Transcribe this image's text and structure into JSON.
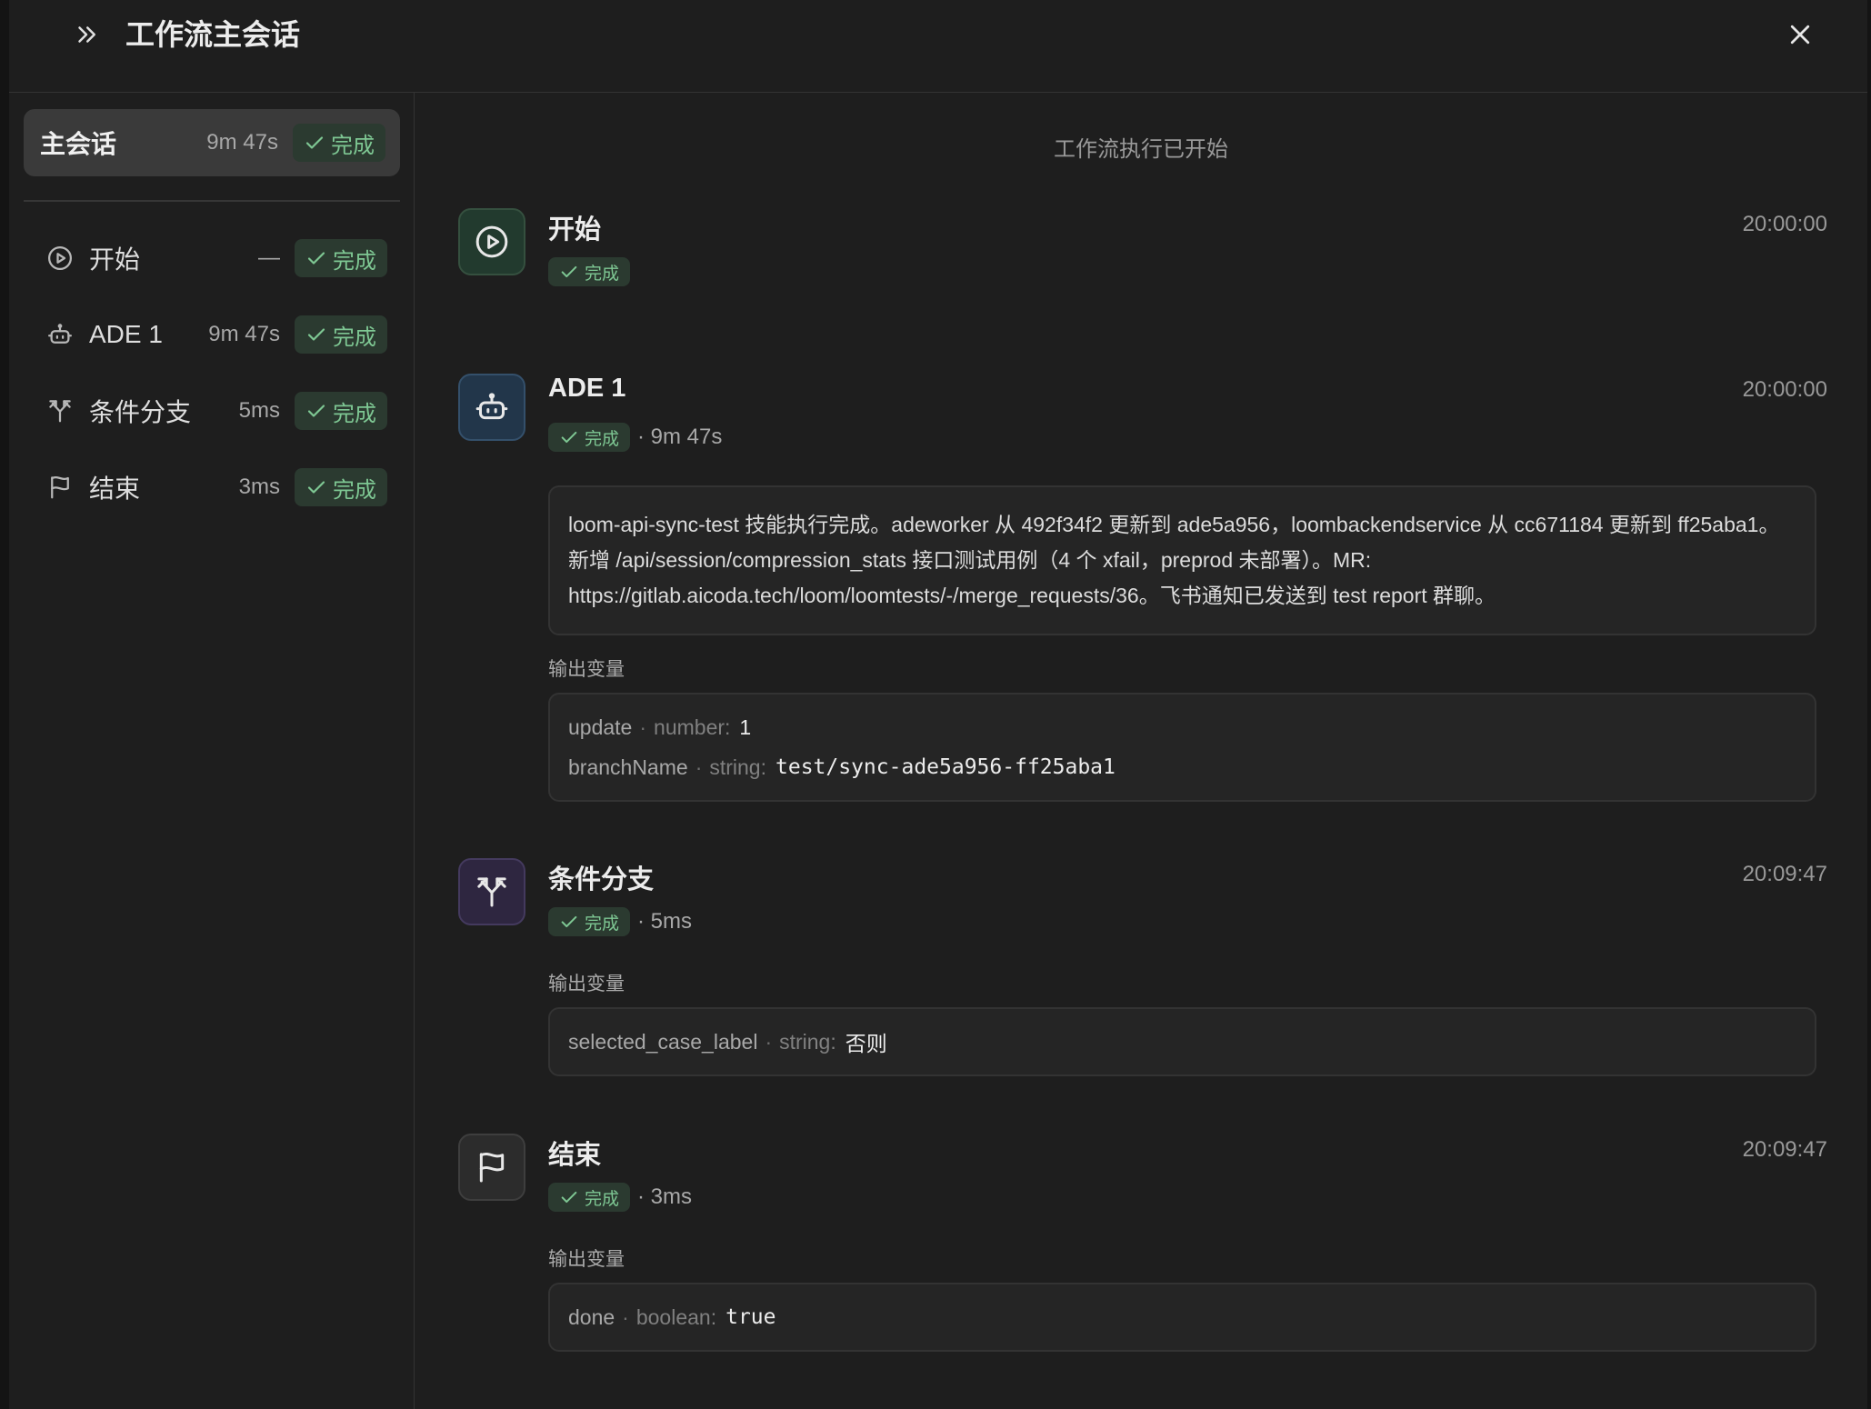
{
  "header": {
    "title": "工作流主会话"
  },
  "sidebar": {
    "main": {
      "label": "主会话",
      "duration": "9m 47s",
      "status": "完成"
    },
    "steps": [
      {
        "label": "开始",
        "duration": "—",
        "status": "完成",
        "icon": "play-circle-icon"
      },
      {
        "label": "ADE 1",
        "duration": "9m 47s",
        "status": "完成",
        "icon": "bot-icon"
      },
      {
        "label": "条件分支",
        "duration": "5ms",
        "status": "完成",
        "icon": "branch-icon"
      },
      {
        "label": "结束",
        "duration": "3ms",
        "status": "完成",
        "icon": "flag-icon"
      }
    ]
  },
  "main": {
    "started_text": "工作流执行已开始",
    "nodes": [
      {
        "title": "开始",
        "time": "20:00:00",
        "status": "完成",
        "icon": "play-circle-icon",
        "icon_bg": "#223a2e",
        "icon_border": "#35503f"
      },
      {
        "title": "ADE 1",
        "time": "20:00:00",
        "status": "完成",
        "duration": "· 9m 47s",
        "icon": "bot-icon",
        "icon_bg": "#22364a",
        "icon_border": "#34506b",
        "message": "loom-api-sync-test 技能执行完成。adeworker 从 492f34f2 更新到 ade5a956，loombackendservice 从 cc671184 更新到 ff25aba1。新增 /api/session/compression_stats 接口测试用例（4 个 xfail，preprod 未部署）。MR: https://gitlab.aicoda.tech/loom/loomtests/-/merge_requests/36。飞书通知已发送到 test report 群聊。",
        "output_label": "输出变量",
        "vars": [
          {
            "name": "update",
            "type": "number:",
            "value": "1"
          },
          {
            "name": "branchName",
            "type": "string:",
            "value": "test/sync-ade5a956-ff25aba1"
          }
        ]
      },
      {
        "title": "条件分支",
        "time": "20:09:47",
        "status": "完成",
        "duration": "· 5ms",
        "icon": "branch-icon",
        "icon_bg": "#2e2640",
        "icon_border": "#443a5e",
        "output_label": "输出变量",
        "vars": [
          {
            "name": "selected_case_label",
            "type": "string:",
            "value": "否则"
          }
        ]
      },
      {
        "title": "结束",
        "time": "20:09:47",
        "status": "完成",
        "duration": "· 3ms",
        "icon": "flag-icon",
        "icon_bg": "#2c2c2c",
        "icon_border": "#3e3e3e",
        "output_label": "输出变量",
        "vars": [
          {
            "name": "done",
            "type": "boolean:",
            "value": "true"
          }
        ]
      }
    ]
  },
  "colors": {
    "success": "#7ec793",
    "success_bg": "#2b3a30",
    "panel": "#1e1e1e"
  }
}
